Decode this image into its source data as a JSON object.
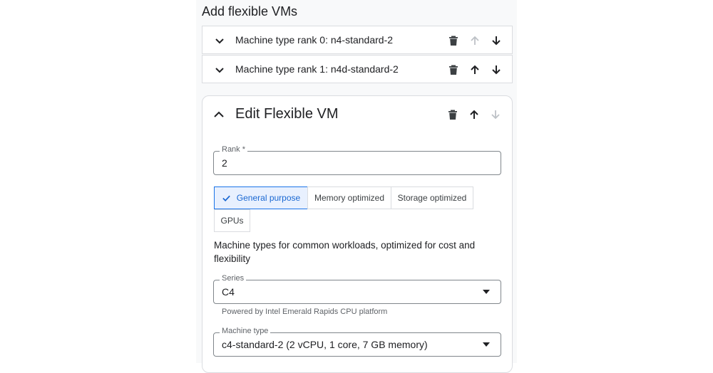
{
  "page": {
    "title": "Add flexible VMs"
  },
  "ranks": [
    {
      "label": "Machine type rank 0: n4-standard-2",
      "up_enabled": false,
      "down_enabled": true
    },
    {
      "label": "Machine type rank 1: n4d-standard-2",
      "up_enabled": true,
      "down_enabled": true
    }
  ],
  "edit": {
    "title": "Edit Flexible VM",
    "down_enabled": false,
    "rank": {
      "label": "Rank *",
      "value": "2"
    },
    "categories": [
      "General purpose",
      "Memory optimized",
      "Storage optimized",
      "GPUs"
    ],
    "selected_category": "General purpose",
    "description": "Machine types for common workloads, optimized for cost and flexibility",
    "series": {
      "label": "Series",
      "value": "C4",
      "hint": "Powered by Intel Emerald Rapids CPU platform"
    },
    "machine_type": {
      "label": "Machine type",
      "value": "c4-standard-2 (2 vCPU, 1 core, 7 GB memory)"
    }
  },
  "colors": {
    "accent": "#1a73e8",
    "selected_bg": "#e8f0fe",
    "disabled": "#bdc1c6"
  }
}
